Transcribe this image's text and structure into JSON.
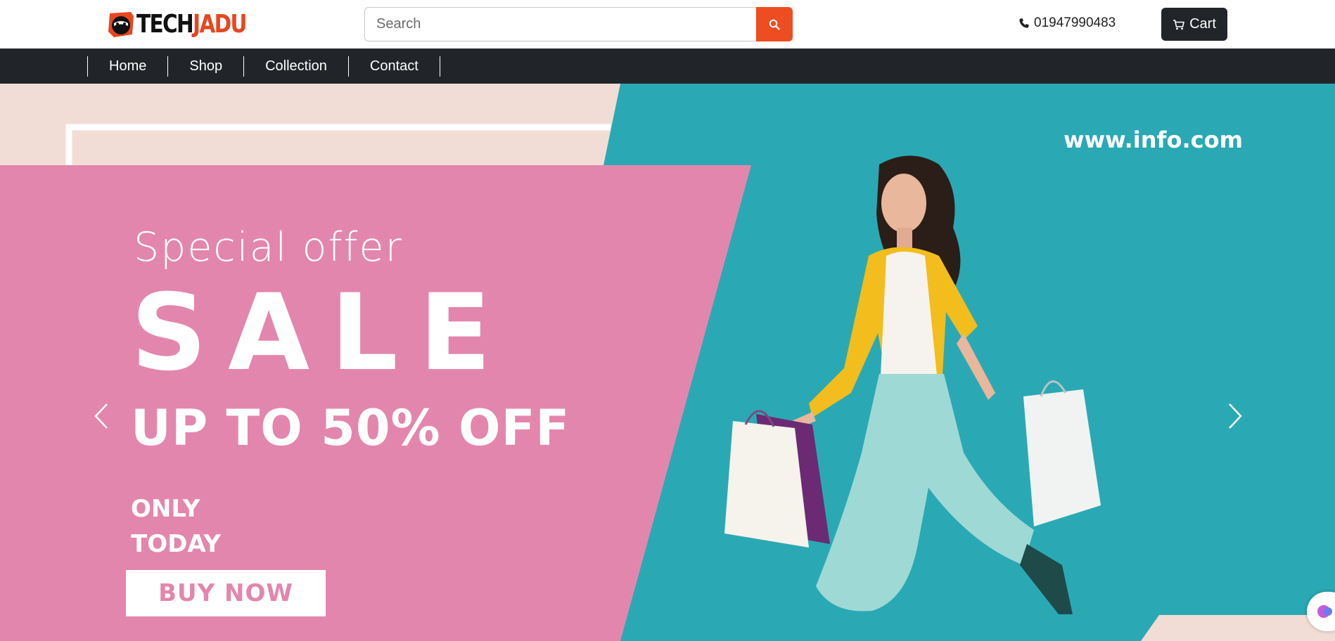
{
  "header": {
    "logo": {
      "part1": "TECH",
      "part2": "JADU"
    },
    "search": {
      "placeholder": "Search",
      "value": ""
    },
    "search_button_icon": "search-icon",
    "phone": {
      "icon": "phone-icon",
      "number": "01947990483"
    },
    "cart": {
      "icon": "cart-icon",
      "label": "Cart"
    }
  },
  "nav": {
    "items": [
      {
        "label": "Home"
      },
      {
        "label": "Shop"
      },
      {
        "label": "Collection"
      },
      {
        "label": "Contact"
      }
    ]
  },
  "hero": {
    "special": "Special offer",
    "sale": "SALE",
    "upto": "UP TO 50% OFF",
    "only_line1": "ONLY",
    "only_line2": "TODAY",
    "buy_label": "BUY NOW",
    "website": "www.info.com",
    "prev_icon": "chevron-left-icon",
    "next_icon": "chevron-right-icon"
  },
  "colors": {
    "brand_orange": "#ee4d22",
    "dark": "#212529",
    "hero_pink": "#e386ad",
    "hero_teal": "#2aa9b4",
    "hero_blush": "#f2ddd6"
  }
}
